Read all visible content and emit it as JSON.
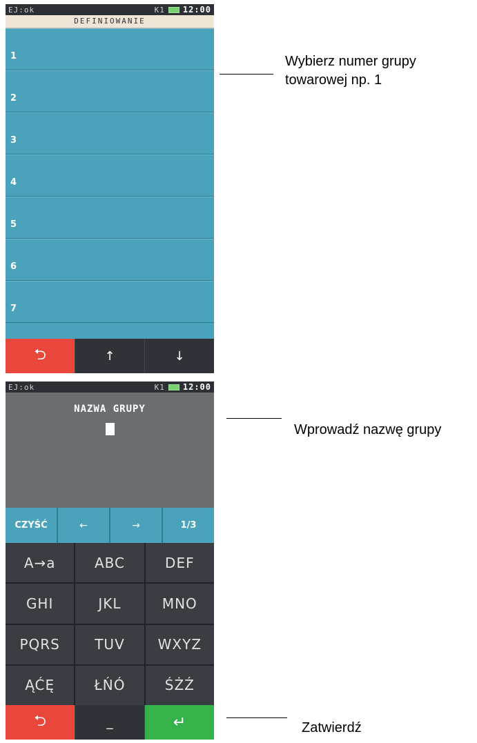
{
  "screen1": {
    "status": {
      "left": "EJ:ok",
      "k": "K1",
      "clock": "12:00"
    },
    "title": "DEFINIOWANIE",
    "items": [
      "1",
      "2",
      "3",
      "4",
      "5",
      "6",
      "7"
    ],
    "bottom": {
      "back": "⮌",
      "up": "↑",
      "down": "↓"
    }
  },
  "screen2": {
    "status": {
      "left": "EJ:ok",
      "k": "K1",
      "clock": "12:00"
    },
    "display_title": "NAZWA GRUPY",
    "edit": {
      "clear": "CZYŚĆ",
      "left": "←",
      "right": "→",
      "page": "1/3"
    },
    "keys": [
      "A→a",
      "ABC",
      "DEF",
      "GHI",
      "JKL",
      "MNO",
      "PQRS",
      "TUV",
      "WXYZ",
      "ĄĆĘ",
      "ŁŃÓ",
      "ŚŻŹ"
    ],
    "bottom": {
      "back": "⮌",
      "space": "_",
      "enter": "↵"
    }
  },
  "callouts": {
    "select_group": [
      "Wybierz numer grupy",
      "towarowej np. 1"
    ],
    "enter_name": "Wprowadź nazwę grupy",
    "confirm": "Zatwierdź"
  },
  "colors": {
    "list_blue": "#4aa3ba",
    "red": "#e9473b",
    "green": "#35b34a",
    "dark": "#2a2d31"
  }
}
